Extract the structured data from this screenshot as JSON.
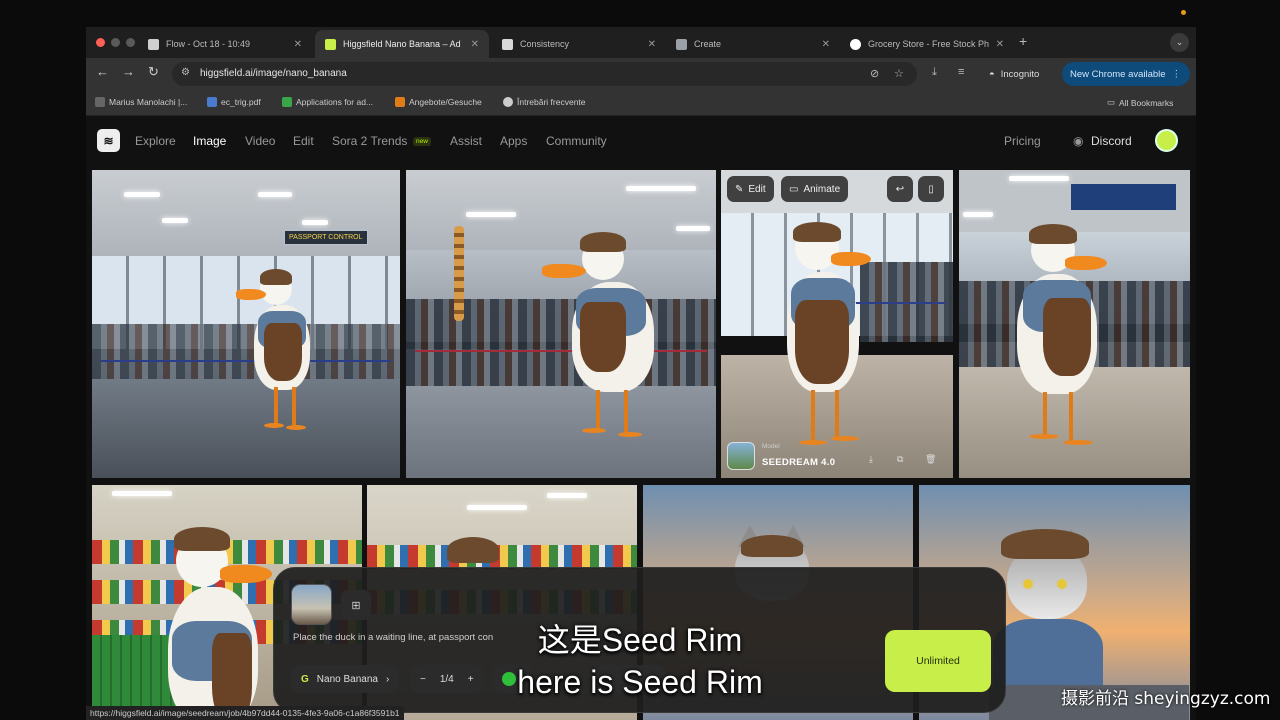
{
  "browser": {
    "tabs": [
      {
        "title": "Flow - Oct 18 - 10:49",
        "favicon_color": "#cfcfcf",
        "active": false
      },
      {
        "title": "Higgsfield Nano Banana – Ad",
        "favicon_color": "#c8ee49",
        "active": true
      },
      {
        "title": "Consistency",
        "favicon_color": "#d8d8d8",
        "active": false
      },
      {
        "title": "Create",
        "favicon_color": "#9aa0a6",
        "active": false
      },
      {
        "title": "Grocery Store - Free Stock Ph",
        "favicon_color": "#ffffff",
        "active": false
      }
    ],
    "url": "higgsfield.ai/image/nano_banana",
    "incognito_label": "Incognito",
    "update_label": "New Chrome available",
    "bookmarks": [
      {
        "label": "Marius Manolachi |...",
        "color": "#666"
      },
      {
        "label": "ec_trig.pdf",
        "color": "#4a7bd0"
      },
      {
        "label": "Applications for ad...",
        "color": "#3aa54a"
      },
      {
        "label": "Angebote/Gesuche",
        "color": "#e07b1a"
      },
      {
        "label": "Întrebări frecvente",
        "color": "#cccccc"
      }
    ],
    "all_bookmarks_label": "All Bookmarks",
    "status_url": "https://higgsfield.ai/image/seedream/job/4b97dd44-0135-4fe3-9a06-c1a86f3591b1"
  },
  "site": {
    "nav": [
      "Explore",
      "Image",
      "Video",
      "Edit",
      "Sora 2 Trends",
      "Assist",
      "Apps",
      "Community"
    ],
    "active_nav": "Image",
    "new_badge": "new",
    "pricing": "Pricing",
    "discord": "Discord"
  },
  "gallery": {
    "tile_overlay": {
      "edit_label": "Edit",
      "animate_label": "Animate",
      "model_caption": "Model",
      "model_name": "SEEDREAM 4.0"
    },
    "sign_text": "PASSPORT CONTROL"
  },
  "prompt_panel": {
    "prompt": "Place the duck in a waiting line, at passport con",
    "model": "Nano Banana",
    "count": "1/4",
    "generate_label": "Unlimited"
  },
  "subtitles": {
    "line1": "这是Seed Rim",
    "line2": "here is Seed Rim"
  },
  "watermark": "摄影前沿 sheyingzyz.com",
  "colors": {
    "accent": "#c8ee49",
    "update_button": "#0e4a7a"
  }
}
